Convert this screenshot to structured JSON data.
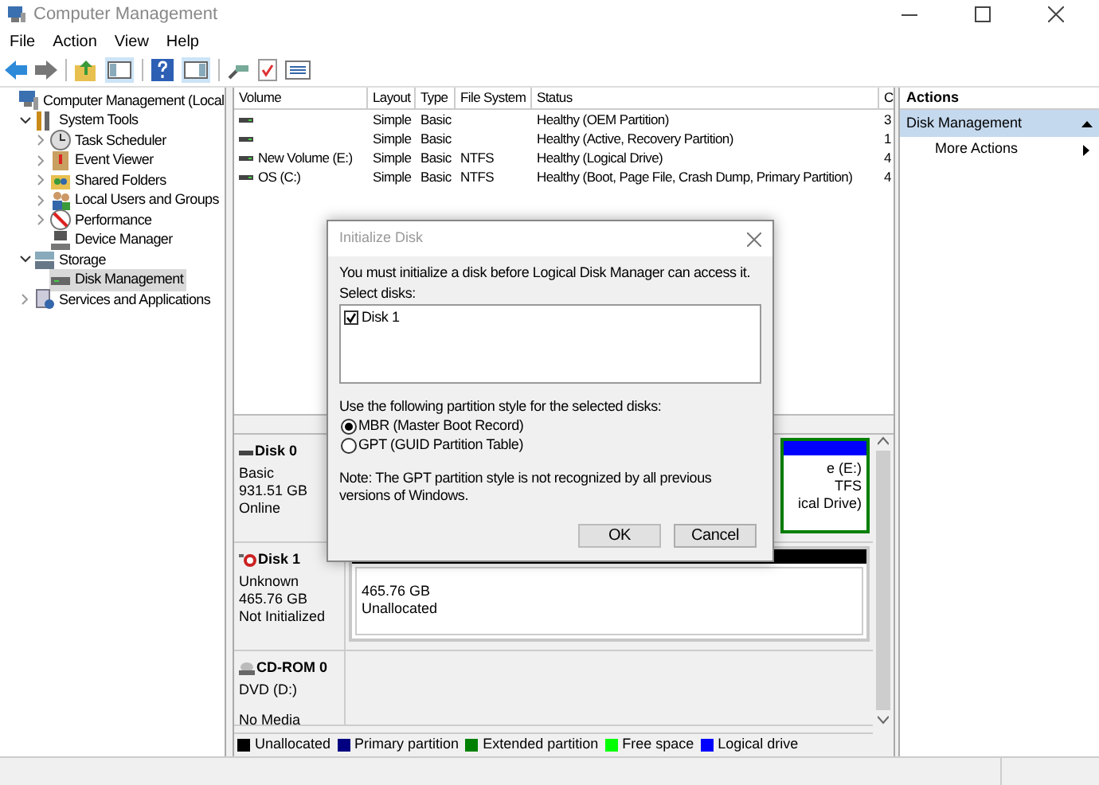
{
  "window": {
    "title": "Computer Management"
  },
  "menu": [
    "File",
    "Action",
    "View",
    "Help"
  ],
  "tree": [
    {
      "label": "Computer Management (Local",
      "selected": false,
      "children": [
        {
          "label": "System Tools",
          "expanded": true,
          "selected": false,
          "children": [
            {
              "label": "Task Scheduler",
              "expanded": false,
              "selected": false
            },
            {
              "label": "Event Viewer",
              "expanded": false,
              "selected": false
            },
            {
              "label": "Shared Folders",
              "expanded": false,
              "selected": false
            },
            {
              "label": "Local Users and Groups",
              "expanded": false,
              "selected": false
            },
            {
              "label": "Performance",
              "expanded": false,
              "selected": false
            },
            {
              "label": "Device Manager",
              "selected": false
            }
          ]
        },
        {
          "label": "Storage",
          "expanded": true,
          "selected": false,
          "children": [
            {
              "label": "Disk Management",
              "selected": true
            }
          ]
        },
        {
          "label": "Services and Applications",
          "expanded": false,
          "selected": false
        }
      ]
    }
  ],
  "table": {
    "columns": [
      "Volume",
      "Layout",
      "Type",
      "File System",
      "Status",
      "C"
    ],
    "rows": [
      {
        "cells": [
          "",
          "Simple",
          "Basic",
          "",
          "Healthy (OEM Partition)",
          "3"
        ]
      },
      {
        "cells": [
          "",
          "Simple",
          "Basic",
          "",
          "Healthy (Active, Recovery Partition)",
          "1"
        ]
      },
      {
        "cells": [
          "New Volume (E:)",
          "Simple",
          "Basic",
          "NTFS",
          "Healthy (Logical Drive)",
          "4"
        ]
      },
      {
        "cells": [
          "OS (C:)",
          "Simple",
          "Basic",
          "NTFS",
          "Healthy (Boot, Page File, Crash Dump, Primary Partition)",
          "4"
        ]
      }
    ]
  },
  "disks": [
    {
      "kind": "basic",
      "name": "Disk 0",
      "lines": [
        "Basic",
        "931.51 GB",
        "Online"
      ],
      "partition": {
        "kind": "logical",
        "lines": [
          "e  (E:)",
          "TFS",
          "ical Drive)"
        ]
      }
    },
    {
      "kind": "uninitialized",
      "name": "Disk 1",
      "lines": [
        "Unknown",
        "465.76 GB",
        "Not Initialized"
      ],
      "partition": {
        "kind": "unallocated",
        "lines": [
          "465.76 GB",
          "Unallocated"
        ]
      }
    },
    {
      "kind": "cdrom",
      "name": "CD-ROM 0",
      "lines": [
        "DVD (D:)",
        "No Media"
      ]
    }
  ],
  "legend": [
    {
      "label": "Unallocated",
      "color": "#000000"
    },
    {
      "label": "Primary partition",
      "color": "#000080"
    },
    {
      "label": "Extended partition",
      "color": "#008000"
    },
    {
      "label": "Free space",
      "color": "#00ff00"
    },
    {
      "label": "Logical drive",
      "color": "#0000ff"
    }
  ],
  "actions": {
    "title": "Actions",
    "section": {
      "label": "Disk Management",
      "expanded": true
    },
    "items": [
      "More Actions"
    ]
  },
  "dialog": {
    "title": "Initialize Disk",
    "message": "You must initialize a disk before Logical Disk Manager can access it.",
    "select_label": "Select disks:",
    "disks": [
      {
        "label": "Disk 1",
        "checked": true
      }
    ],
    "style_label": "Use the following partition style for the selected disks:",
    "options": [
      {
        "label": "MBR (Master Boot Record)",
        "selected": true
      },
      {
        "label": "GPT (GUID Partition Table)",
        "selected": false
      }
    ],
    "note": "Note: The GPT partition style is not recognized by all previous versions of Windows.",
    "buttons": [
      "OK",
      "Cancel"
    ]
  }
}
